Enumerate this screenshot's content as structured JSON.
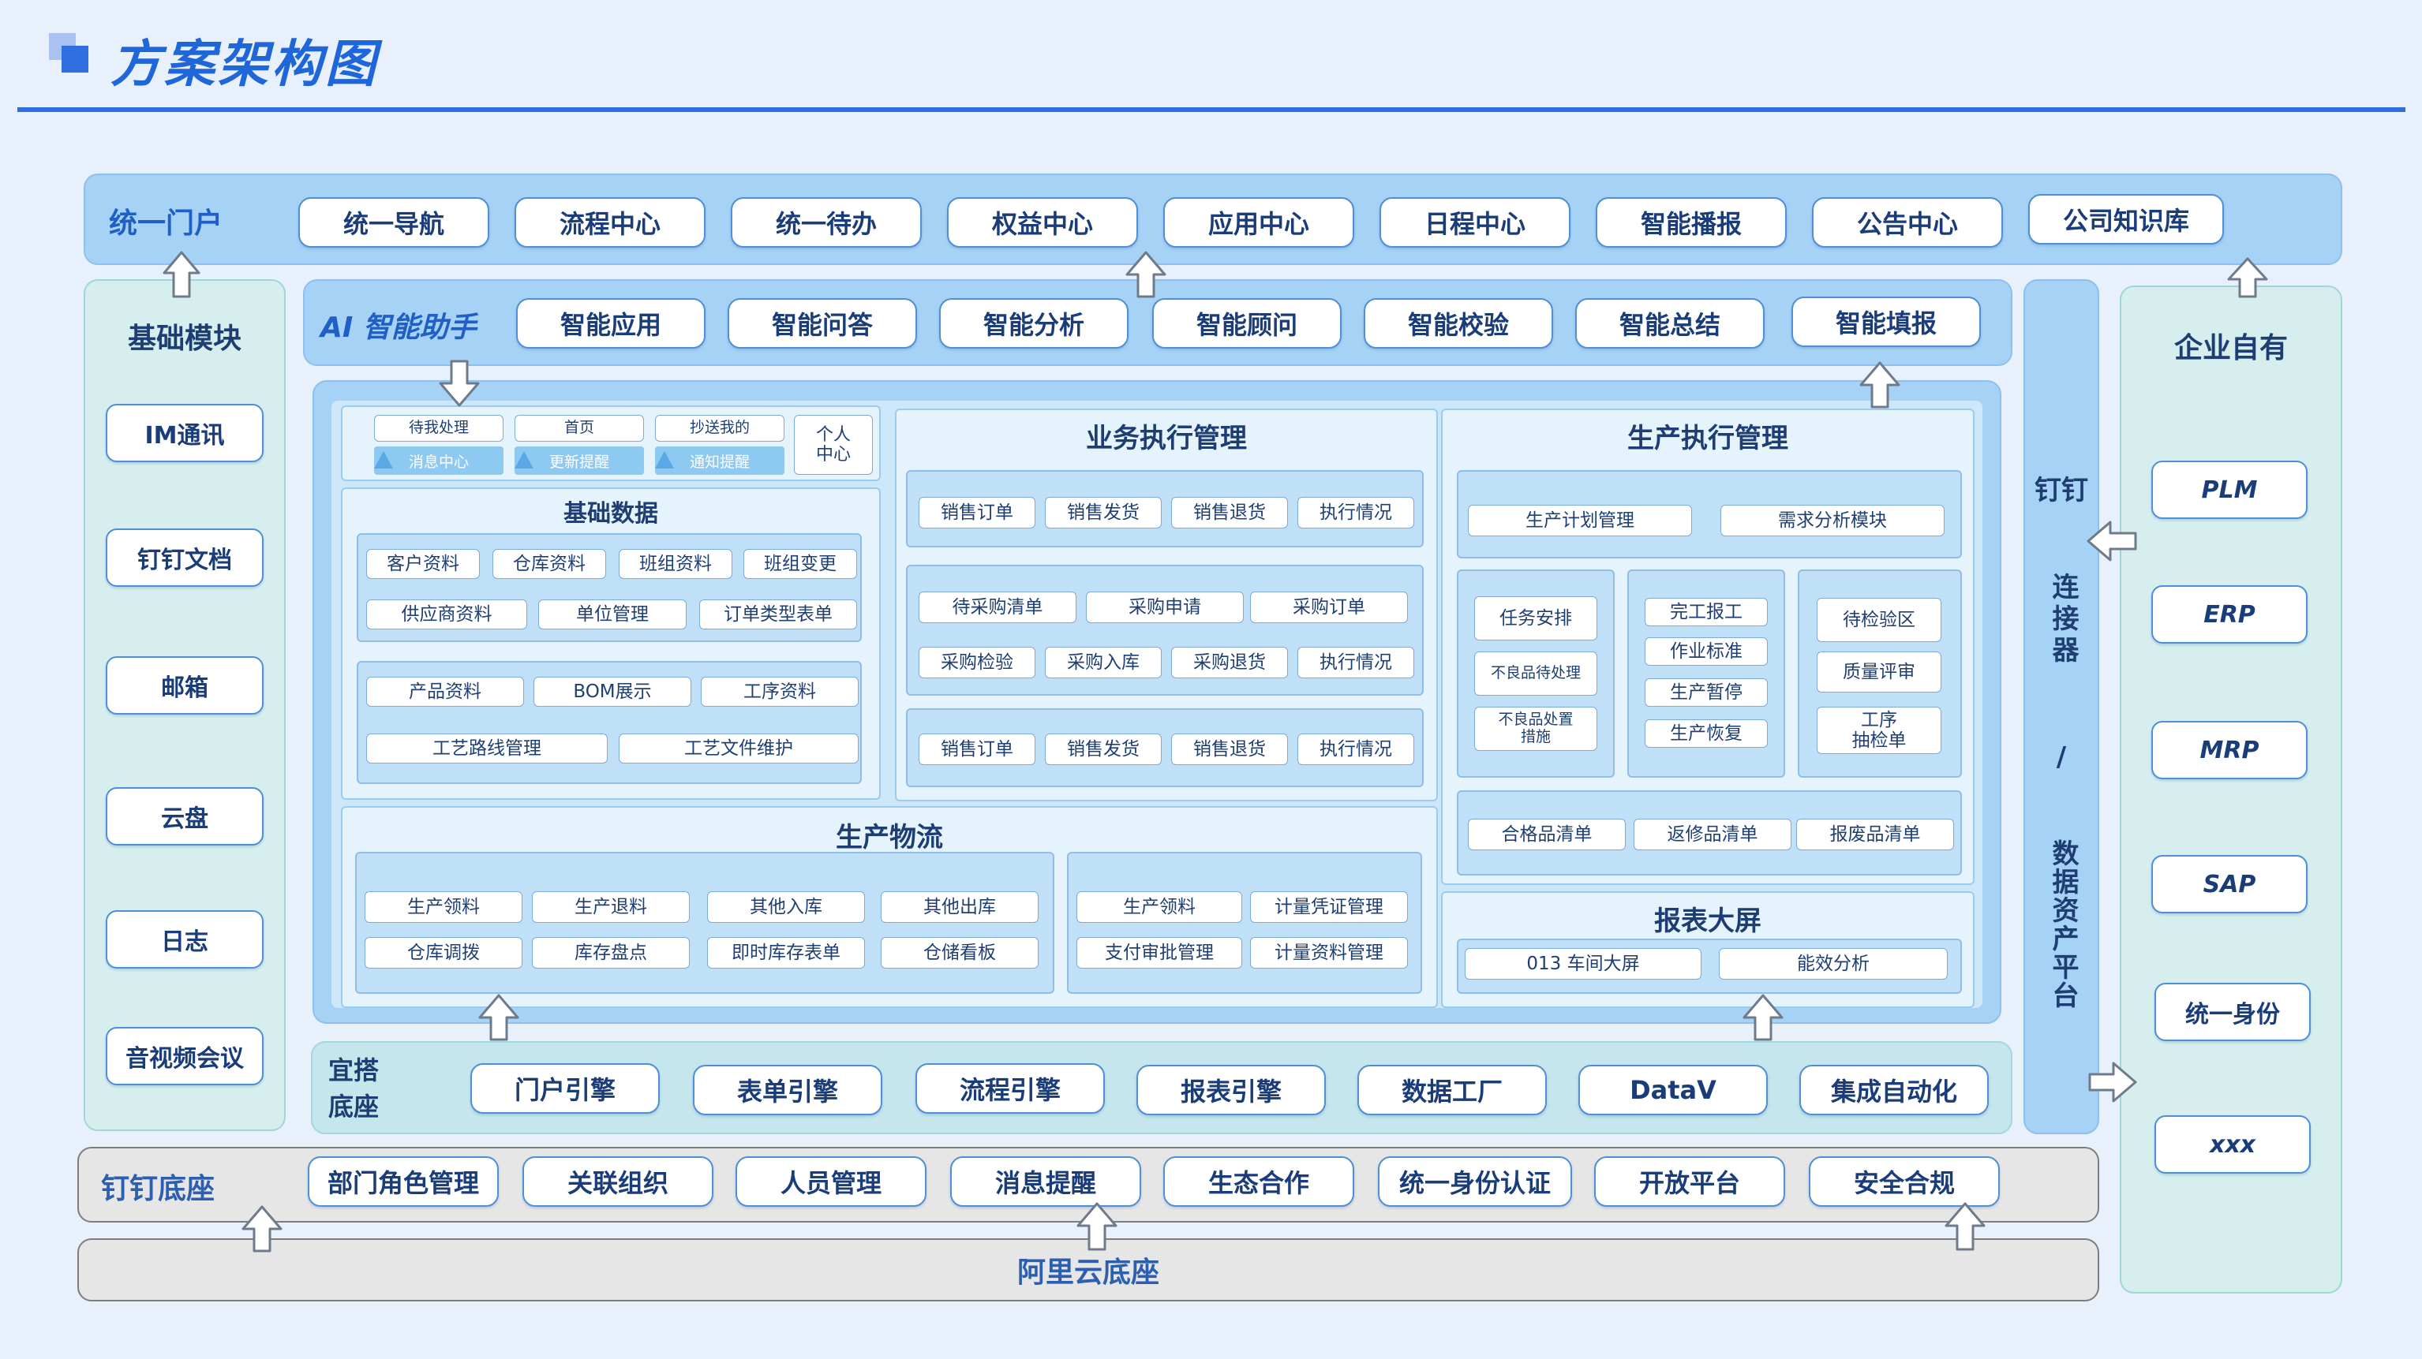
{
  "header": {
    "title": "方案架构图"
  },
  "portal": {
    "label": "统一门户",
    "items": [
      "统一导航",
      "流程中心",
      "统一待办",
      "权益中心",
      "应用中心",
      "日程中心",
      "智能播报",
      "公告中心",
      "公司知识库"
    ]
  },
  "ai": {
    "label": "AI 智能助手",
    "items": [
      "智能应用",
      "智能问答",
      "智能分析",
      "智能顾问",
      "智能校验",
      "智能总结",
      "智能填报"
    ]
  },
  "basic_module": {
    "label": "基础模块",
    "items": [
      "IM通讯",
      "钉钉文档",
      "邮箱",
      "云盘",
      "日志",
      "音视频会议"
    ]
  },
  "enterprise": {
    "label": "企业自有",
    "items": [
      "PLM",
      "ERP",
      "MRP",
      "SAP",
      "统一身份",
      "xxx"
    ]
  },
  "connector": {
    "label": "钉钉连接器/数据资产平台",
    "line1": "钉钉",
    "line2": "连接器",
    "slash": "/",
    "line3": "数据资产平台"
  },
  "personal": {
    "tabs": [
      {
        "top": "待我处理",
        "bottom": "消息中心"
      },
      {
        "top": "首页",
        "bottom": "更新提醒"
      },
      {
        "top": "抄送我的",
        "bottom": "通知提醒"
      }
    ],
    "center": "个人中心",
    "center_l1": "个人",
    "center_l2": "中心"
  },
  "basic_data": {
    "label": "基础数据",
    "row1": [
      "客户资料",
      "仓库资料",
      "班组资料",
      "班组变更"
    ],
    "row2": [
      "供应商资料",
      "单位管理",
      "订单类型表单"
    ],
    "row3": [
      "产品资料",
      "BOM展示",
      "工序资料"
    ],
    "row4": [
      "工艺路线管理",
      "工艺文件维护"
    ]
  },
  "business": {
    "label": "业务执行管理",
    "g1": [
      "销售订单",
      "销售发货",
      "销售退货",
      "执行情况"
    ],
    "g2a": [
      "待采购清单",
      "采购申请",
      "采购订单"
    ],
    "g2b": [
      "采购检验",
      "采购入库",
      "采购退货",
      "执行情况"
    ],
    "g3": [
      "销售订单",
      "销售发货",
      "销售退货",
      "执行情况"
    ]
  },
  "production": {
    "label": "生产执行管理",
    "plan": [
      "生产计划管理",
      "需求分析模块"
    ],
    "col1": [
      "任务安排",
      "不良品待处理",
      "不良品处置措施"
    ],
    "col1_c_l1": "不良品处置",
    "col1_c_l2": "措施",
    "col2": [
      "完工报工",
      "作业标准",
      "生产暂停",
      "生产恢复"
    ],
    "col3": [
      "待检验区",
      "质量评审",
      "工序抽检单"
    ],
    "col3_c_l1": "工序",
    "col3_c_l2": "抽检单",
    "bottom": [
      "合格品清单",
      "返修品清单",
      "报废品清单"
    ]
  },
  "logistics": {
    "label": "生产物流",
    "left_r1": [
      "生产领料",
      "生产退料",
      "其他入库",
      "其他出库"
    ],
    "left_r2": [
      "仓库调拨",
      "库存盘点",
      "即时库存表单",
      "仓储看板"
    ],
    "right_r1": [
      "生产领料",
      "计量凭证管理"
    ],
    "right_r2": [
      "支付审批管理",
      "计量资料管理"
    ]
  },
  "report": {
    "label": "报表大屏",
    "items": [
      "013 车间大屏",
      "能效分析"
    ]
  },
  "yida": {
    "label": "宜搭底座",
    "label_l1": "宜搭",
    "label_l2": "底座",
    "items": [
      "门户引擎",
      "表单引擎",
      "流程引擎",
      "报表引擎",
      "数据工厂",
      "DataV",
      "集成自动化"
    ]
  },
  "dingtalk": {
    "label": "钉钉底座",
    "items": [
      "部门角色管理",
      "关联组织",
      "人员管理",
      "消息提醒",
      "生态合作",
      "统一身份认证",
      "开放平台",
      "安全合规"
    ]
  },
  "aliyun": {
    "label": "阿里云底座"
  },
  "colors": {
    "accent": "#1f66d8",
    "panel": "#a6d2f5",
    "teal": "#d6efee",
    "grey": "#e6e6e6"
  }
}
